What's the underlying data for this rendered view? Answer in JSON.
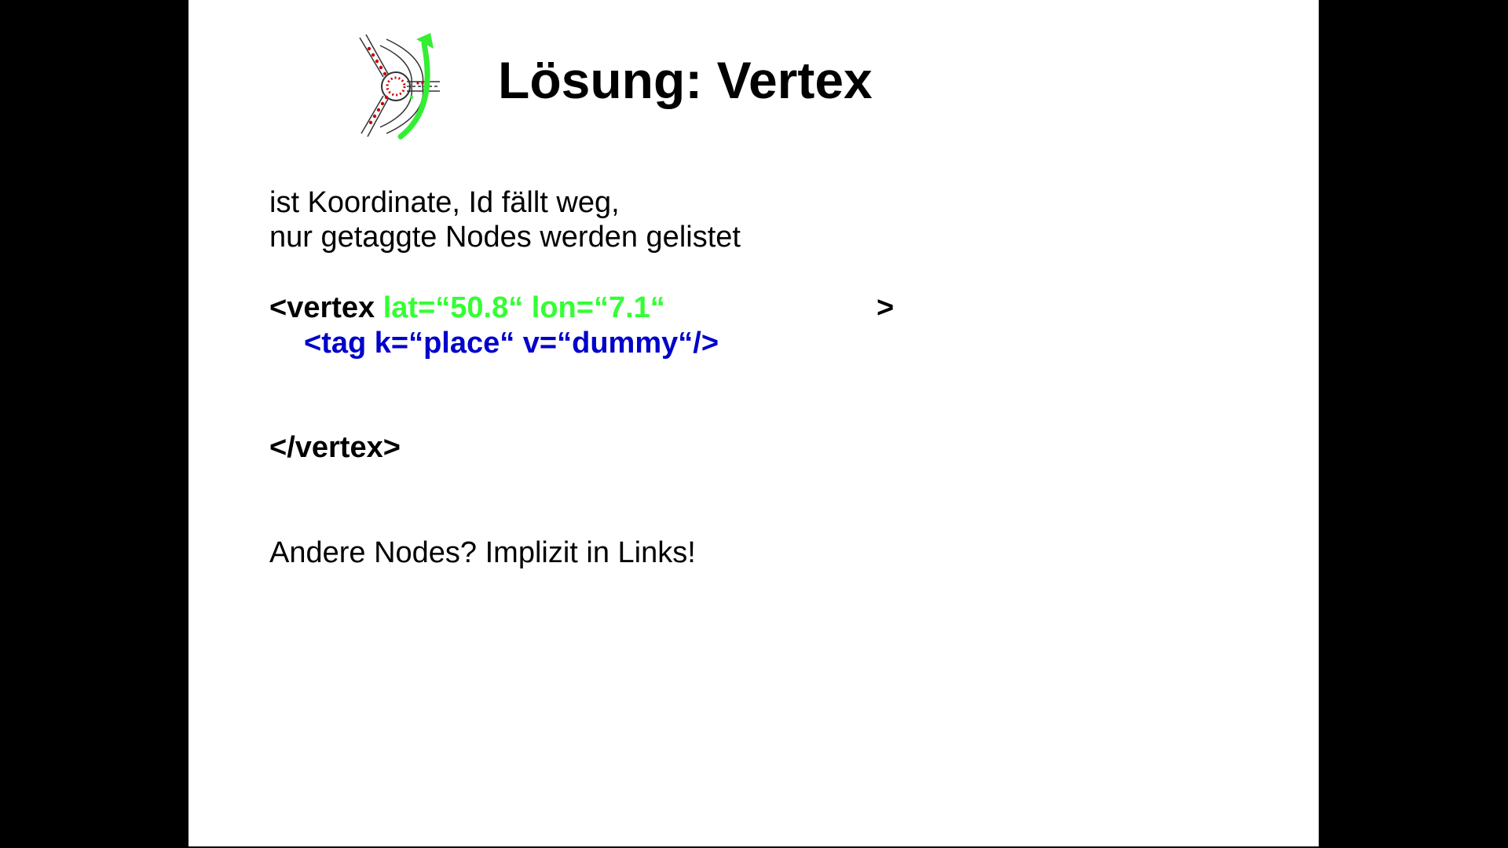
{
  "slide": {
    "title": "Lösung: Vertex",
    "intro_line_1": "ist Koordinate, Id fällt weg,",
    "intro_line_2": "nur getaggte Nodes werden gelistet",
    "code": {
      "open_tag": "<vertex",
      "attributes": "lat=“50.8“ lon=“7.1“",
      "open_tag_close": ">",
      "tag_line": "<tag k=“place“ v=“dummy“/>",
      "close_tag": "</vertex>"
    },
    "closing_line": "Andere Nodes? Implizit in Links!"
  },
  "colors": {
    "background": "#000000",
    "slide": "#ffffff",
    "attributes": "#33ff33",
    "tag_line": "#0000cc",
    "logo_arrow": "#33ee33",
    "logo_dots": "#cc0000"
  },
  "icons": {
    "logo": "roundabout-logo"
  }
}
